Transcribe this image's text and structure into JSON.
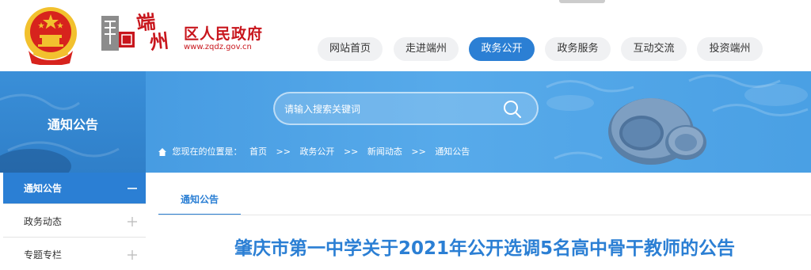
{
  "site": {
    "name": "区人民政府",
    "calligraphy": [
      "端",
      "州"
    ],
    "url": "www.zqdz.gov.cn",
    "seal_text": "端"
  },
  "nav": {
    "items": [
      {
        "label": "网站首页",
        "active": false
      },
      {
        "label": "走进端州",
        "active": false
      },
      {
        "label": "政务公开",
        "active": true
      },
      {
        "label": "政务服务",
        "active": false
      },
      {
        "label": "互动交流",
        "active": false
      },
      {
        "label": "投资端州",
        "active": false
      }
    ]
  },
  "banner": {
    "section_title": "通知公告"
  },
  "search": {
    "placeholder": "请输入搜索关键词",
    "value": ""
  },
  "breadcrumb": {
    "prefix": "您现在的位置是：",
    "separator": ">>",
    "items": [
      "首页",
      "政务公开",
      "新闻动态",
      "通知公告"
    ]
  },
  "sidebar": {
    "items": [
      {
        "label": "通知公告",
        "active": true,
        "toggle": "−"
      },
      {
        "label": "政务动态",
        "active": false,
        "toggle": "+"
      },
      {
        "label": "专题专栏",
        "active": false,
        "toggle": "+"
      }
    ]
  },
  "main": {
    "tab_label": "通知公告",
    "article_title": "肇庆市第一中学关于2021年公开选调5名高中骨干教师的公告"
  },
  "colors": {
    "accent": "#2b7fd4",
    "brand_red": "#c8161d",
    "emblem_gold": "#f2c12e",
    "emblem_red": "#d7231d"
  }
}
